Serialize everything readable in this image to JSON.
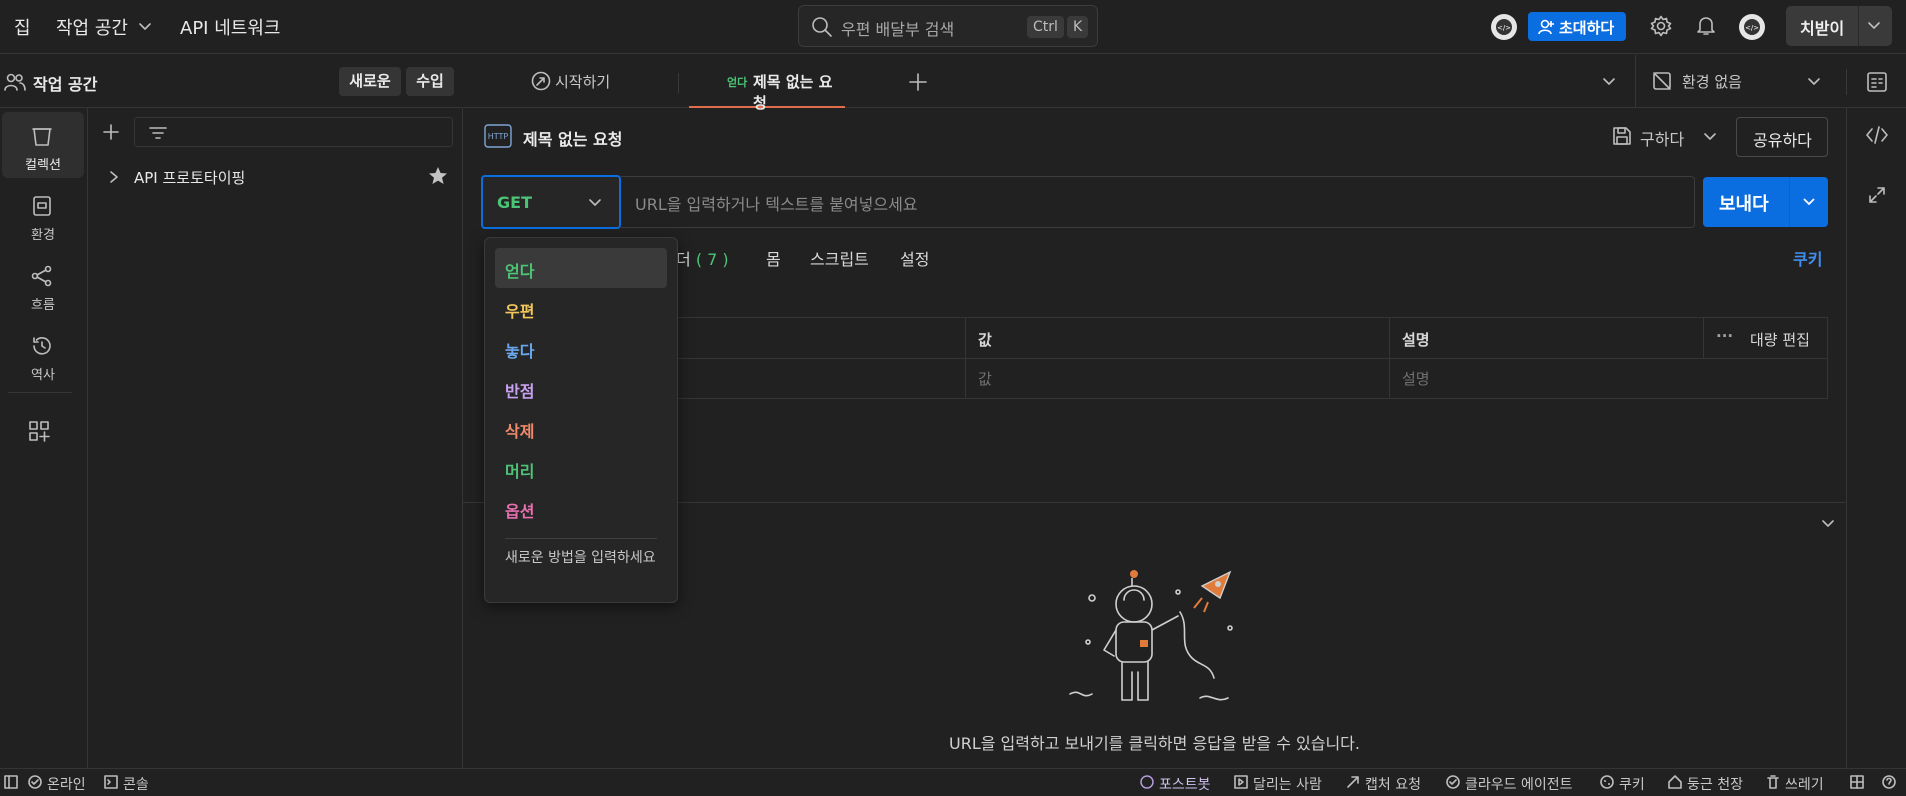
{
  "topbar": {
    "home": "집",
    "workspace": "작업 공간",
    "api_network": "API 네트워크",
    "search_placeholder": "우편 배달부 검색",
    "kbd_ctrl": "Ctrl",
    "kbd_k": "K",
    "invite": "초대하다",
    "upgrade": "치받이"
  },
  "workspace_header": {
    "title": "작업 공간",
    "new": "새로운",
    "import": "수입"
  },
  "rail": [
    {
      "label": "컬렉션",
      "icon": "collections-icon"
    },
    {
      "label": "환경",
      "icon": "environment-icon"
    },
    {
      "label": "흐름",
      "icon": "flows-icon"
    },
    {
      "label": "역사",
      "icon": "history-icon"
    }
  ],
  "sidebar": {
    "collection_name": "API 프로토타이핑"
  },
  "tabs": {
    "getting_started": "시작하기",
    "active_method": "얻다",
    "active_title": "제목 없는 요청",
    "environment": "환경 없음"
  },
  "request": {
    "title": "제목 없는 요청",
    "save": "구하다",
    "share": "공유하다",
    "method": "GET",
    "url_placeholder": "URL을 입력하거나 텍스트를 붙여넣으세요",
    "send": "보내다"
  },
  "subtabs": {
    "headers": "더",
    "headers_count": "( 7 )",
    "body": "몸",
    "scripts": "스크립트",
    "settings": "설정",
    "cookies": "쿠키"
  },
  "params_table": {
    "col_value": "값",
    "col_description": "설명",
    "bulk_edit": "대량 편집",
    "value_placeholder": "값",
    "description_placeholder": "설명"
  },
  "dropdown": {
    "options": [
      {
        "label": "얻다",
        "color": "#4cc476"
      },
      {
        "label": "우편",
        "color": "#f1c65a"
      },
      {
        "label": "놓다",
        "color": "#6aa7ee"
      },
      {
        "label": "반점",
        "color": "#c8a2f0"
      },
      {
        "label": "삭제",
        "color": "#ee8a6a"
      },
      {
        "label": "머리",
        "color": "#4cc476"
      },
      {
        "label": "옵션",
        "color": "#e66fb0"
      }
    ],
    "custom_placeholder": "새로운 방법을 입력하세요"
  },
  "response": {
    "hint": "URL을 입력하고 보내기를 클릭하면 응답을 받을 수 있습니다."
  },
  "status": {
    "online": "온라인",
    "console": "콘솔",
    "postbot": "포스트봇",
    "runner": "달리는 사람",
    "capture": "캡처 요청",
    "cloud_agent": "클라우드 에이전트",
    "cookies": "쿠키",
    "vault": "둥근 천장",
    "trash": "쓰레기"
  },
  "colors": {
    "accent": "#0b6ee0",
    "tab_underline": "#e06c4b",
    "get": "#4cc476"
  }
}
